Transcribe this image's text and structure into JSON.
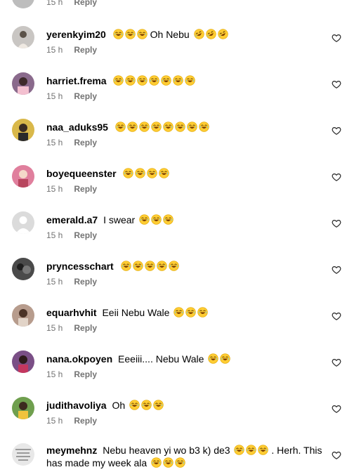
{
  "top_partial": {
    "time": "15 h",
    "reply_label": "Reply"
  },
  "comments": [
    {
      "username": "yerenkyim20",
      "text": "Oh Nebu",
      "emojis_before": 3,
      "emojis_after": 3,
      "emoji_after_type": "rofl",
      "time": "15 h",
      "reply_label": "Reply",
      "avatar_color": "#c9c6c3"
    },
    {
      "username": "harriet.frema",
      "text": "",
      "emojis_before": 7,
      "time": "15 h",
      "reply_label": "Reply",
      "avatar_color": "#8a6a8c"
    },
    {
      "username": "naa_aduks95",
      "text": "",
      "emojis_before": 8,
      "time": "15 h",
      "reply_label": "Reply",
      "avatar_color": "#d9b84a"
    },
    {
      "username": "boyequeenster",
      "text": "",
      "emojis_before": 4,
      "time": "15 h",
      "reply_label": "Reply",
      "avatar_color": "#e07f9d"
    },
    {
      "username": "emerald.a7",
      "text": "I swear",
      "emojis_after": 3,
      "emoji_after_type": "laugh",
      "time": "15 h",
      "reply_label": "Reply",
      "avatar_color": "#dbdbdb"
    },
    {
      "username": "pryncesschart",
      "text": "",
      "emojis_before": 5,
      "time": "15 h",
      "reply_label": "Reply",
      "avatar_color": "#4a4a4a"
    },
    {
      "username": "equarhvhit",
      "text": "Eeii Nebu Wale",
      "emojis_after": 3,
      "emoji_after_type": "laugh",
      "time": "15 h",
      "reply_label": "Reply",
      "avatar_color": "#b79c8d"
    },
    {
      "username": "nana.okpoyen",
      "text": "Eeeiii.... Nebu Wale",
      "emojis_after": 2,
      "emoji_after_type": "laugh",
      "time": "15 h",
      "reply_label": "Reply",
      "avatar_color": "#7a4f86"
    },
    {
      "username": "judithavoliya",
      "text": "Oh",
      "emojis_after": 3,
      "emoji_after_type": "laugh",
      "time": "15 h",
      "reply_label": "Reply",
      "avatar_color": "#6f9f4e"
    },
    {
      "username": "meymehnz",
      "text_line1": "Nebu heaven yi wo b3 k) de3",
      "text_line1_suffix": ". Herh. This",
      "text_line2": "has made my week ala",
      "emojis_line1": 3,
      "emojis_line2": 3,
      "avatar_color": "#e8e8e8"
    }
  ],
  "icons": {
    "like": "heart-outline-icon",
    "emoji_laugh": "face-with-tears-of-joy-icon",
    "emoji_rofl": "rolling-on-floor-laughing-icon"
  }
}
